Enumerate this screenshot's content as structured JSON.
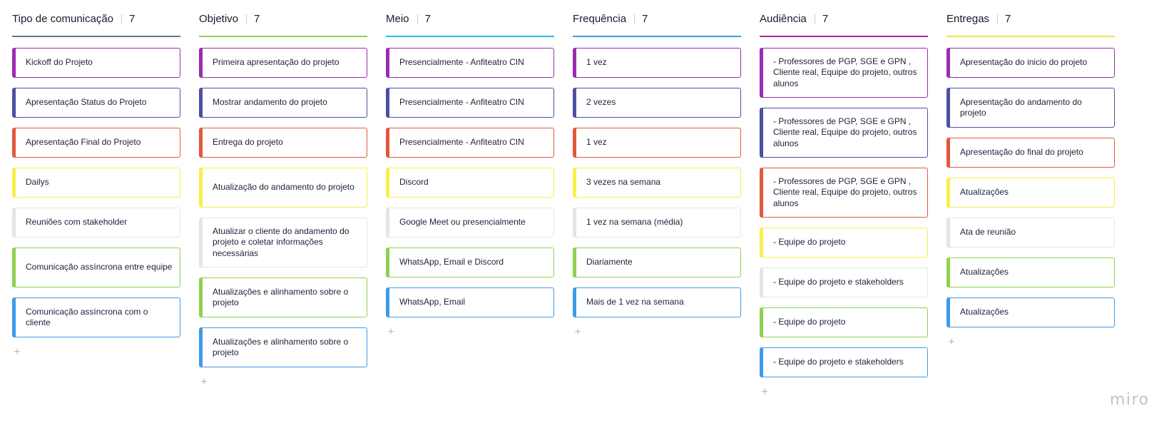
{
  "colors": {
    "purple": "#9b2bb0",
    "indigo": "#4c4fa3",
    "red": "#e2583c",
    "yellow": "#f8ef4a",
    "gray": "#e5e5e8",
    "green": "#8fd14f",
    "blue": "#3d9be9",
    "teal": "#23bfd9",
    "slate": "#6e6f8f"
  },
  "columns": [
    {
      "title": "Tipo de comunicação",
      "count": "7",
      "line_color": "#6e6f8f",
      "add_label": "+",
      "cards": [
        {
          "text": "Kickoff do Projeto",
          "color": "#9b2bb0"
        },
        {
          "text": "Apresentação Status do Projeto",
          "color": "#4c4fa3"
        },
        {
          "text": "Apresentação Final do Projeto",
          "color": "#e2583c"
        },
        {
          "text": "Dailys",
          "color": "#f8ef4a"
        },
        {
          "text": "Reuniões com stakeholder",
          "color": "#e5e5e8"
        },
        {
          "text": "Comunicação assíncrona entre equipe",
          "color": "#8fd14f"
        },
        {
          "text": "Comunicação assíncrona com o cliente",
          "color": "#3d9be9"
        }
      ]
    },
    {
      "title": "Objetivo",
      "count": "7",
      "line_color": "#8fd14f",
      "add_label": "+",
      "cards": [
        {
          "text": "Primeira apresentação do projeto",
          "color": "#9b2bb0"
        },
        {
          "text": "Mostrar andamento do projeto",
          "color": "#4c4fa3"
        },
        {
          "text": "Entrega do projeto",
          "color": "#e2583c"
        },
        {
          "text": "Atualização do andamento do projeto",
          "color": "#f8ef4a"
        },
        {
          "text": "Atualizar o cliente do andamento do projeto e coletar informações necessárias",
          "color": "#e5e5e8"
        },
        {
          "text": "Atualizações e alinhamento sobre o projeto",
          "color": "#8fd14f"
        },
        {
          "text": "Atualizações e alinhamento sobre o projeto",
          "color": "#3d9be9"
        }
      ]
    },
    {
      "title": "Meio",
      "count": "7",
      "line_color": "#23bfd9",
      "add_label": "+",
      "cards": [
        {
          "text": "Presencialmente - Anfiteatro CIN",
          "color": "#9b2bb0"
        },
        {
          "text": "Presencialmente - Anfiteatro CIN",
          "color": "#4c4fa3"
        },
        {
          "text": "Presencialmente - Anfiteatro CIN",
          "color": "#e2583c"
        },
        {
          "text": "Discord",
          "color": "#f8ef4a"
        },
        {
          "text": "Google Meet ou presencialmente",
          "color": "#e5e5e8"
        },
        {
          "text": "WhatsApp, Email e Discord",
          "color": "#8fd14f"
        },
        {
          "text": "WhatsApp, Email",
          "color": "#3d9be9"
        }
      ]
    },
    {
      "title": "Frequência",
      "count": "7",
      "line_color": "#3d9be9",
      "add_label": "+",
      "cards": [
        {
          "text": "1 vez",
          "color": "#9b2bb0"
        },
        {
          "text": "2 vezes",
          "color": "#4c4fa3"
        },
        {
          "text": "1 vez",
          "color": "#e2583c"
        },
        {
          "text": "3 vezes na semana",
          "color": "#f8ef4a"
        },
        {
          "text": "1 vez na semana (média)",
          "color": "#e5e5e8"
        },
        {
          "text": "Diariamente",
          "color": "#8fd14f"
        },
        {
          "text": "Mais de 1 vez na semana",
          "color": "#3d9be9"
        }
      ]
    },
    {
      "title": "Audiência",
      "count": "7",
      "line_color": "#b0249f",
      "add_label": "+",
      "cards": [
        {
          "text": "- Professores de PGP, SGE e GPN , Cliente real, Equipe do projeto, outros alunos",
          "color": "#9b2bb0"
        },
        {
          "text": "- Professores de PGP, SGE e GPN , Cliente real, Equipe do projeto, outros alunos",
          "color": "#4c4fa3"
        },
        {
          "text": "- Professores de PGP, SGE e GPN , Cliente real, Equipe do projeto, outros alunos",
          "color": "#e2583c"
        },
        {
          "text": "- Equipe do projeto",
          "color": "#f8ef4a"
        },
        {
          "text": "- Equipe do projeto e stakeholders",
          "color": "#e5e5e8"
        },
        {
          "text": "- Equipe do projeto",
          "color": "#8fd14f"
        },
        {
          "text": "- Equipe do projeto e stakeholders",
          "color": "#3d9be9"
        }
      ]
    },
    {
      "title": "Entregas",
      "count": "7",
      "line_color": "#f0e442",
      "add_label": "+",
      "cards": [
        {
          "text": "Apresentação do inicio do projeto",
          "color": "#9b2bb0"
        },
        {
          "text": "Apresentação do andamento do projeto",
          "color": "#4c4fa3"
        },
        {
          "text": "Apresentação do final do projeto",
          "color": "#e2583c"
        },
        {
          "text": "Atualizações",
          "color": "#f8ef4a"
        },
        {
          "text": "Ata de reunião",
          "color": "#e5e5e8"
        },
        {
          "text": "Atualizações",
          "color": "#8fd14f"
        },
        {
          "text": "Atualizações",
          "color": "#3d9be9"
        }
      ]
    }
  ],
  "branding": {
    "logo_text": "miro"
  }
}
